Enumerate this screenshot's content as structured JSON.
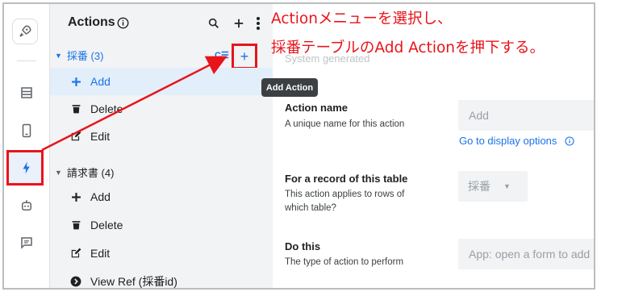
{
  "annotation": {
    "line1": "Actionメニューを選択し、",
    "line2": "採番テーブルのAdd Actionを押下する。"
  },
  "tree": {
    "title": "Actions",
    "tooltip": "Add Action",
    "groups": [
      {
        "label": "採番 (3)",
        "items": [
          {
            "label": "Add"
          },
          {
            "label": "Delete"
          },
          {
            "label": "Edit"
          }
        ]
      },
      {
        "label": "請求書 (4)",
        "items": [
          {
            "label": "Add"
          },
          {
            "label": "Delete"
          },
          {
            "label": "Edit"
          },
          {
            "label": "View Ref (採番id)"
          }
        ]
      }
    ]
  },
  "form": {
    "faded_text": "System generated",
    "action_name": {
      "label": "Action name",
      "desc": "A unique name for this action",
      "value": "Add",
      "link": "Go to display options"
    },
    "table": {
      "label": "For a record of this table",
      "desc": "This action applies to rows of which table?",
      "value": "採番"
    },
    "do_this": {
      "label": "Do this",
      "desc": "The type of action to perform",
      "value": "App: open a form to add"
    }
  },
  "colors": {
    "annotation_red": "#e8141b",
    "accent_blue": "#1a73e8",
    "panel_gray": "#f1f3f4"
  }
}
